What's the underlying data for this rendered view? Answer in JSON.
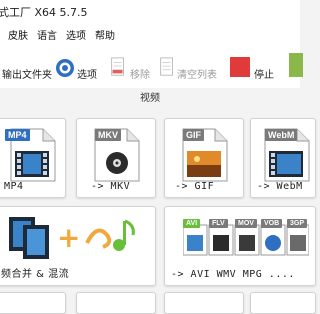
{
  "window": {
    "title": "式工厂 X64 5.7.5"
  },
  "menu": [
    "皮肤",
    "语言",
    "选项",
    "帮助"
  ],
  "toolbar": {
    "output_folder": "输出文件夹",
    "options": "选项",
    "remove": "移除",
    "clear_list": "清空列表",
    "stop": "停止"
  },
  "section": {
    "video_label": "视频"
  },
  "tiles": [
    {
      "badge": "MP4",
      "label": "MP4",
      "badge_color": "#2f6fc2"
    },
    {
      "badge": "MKV",
      "label": "-> MKV",
      "badge_color": "#7a7a7a"
    },
    {
      "badge": "GIF",
      "label": "-> GIF",
      "badge_color": "#7a7a7a"
    },
    {
      "badge": "WebM",
      "label": "-> WebM",
      "badge_color": "#7a7a7a"
    },
    {
      "label": "频合并 & 混流"
    },
    {
      "badges": [
        "AVI",
        "FLV",
        "MOV",
        "VOB",
        "3GP"
      ],
      "label": "-> AVI WMV MPG ...."
    }
  ],
  "colors": {
    "accent_blue": "#2f6fc2",
    "stop_red": "#e03a3a",
    "remove_red": "#e06060"
  }
}
